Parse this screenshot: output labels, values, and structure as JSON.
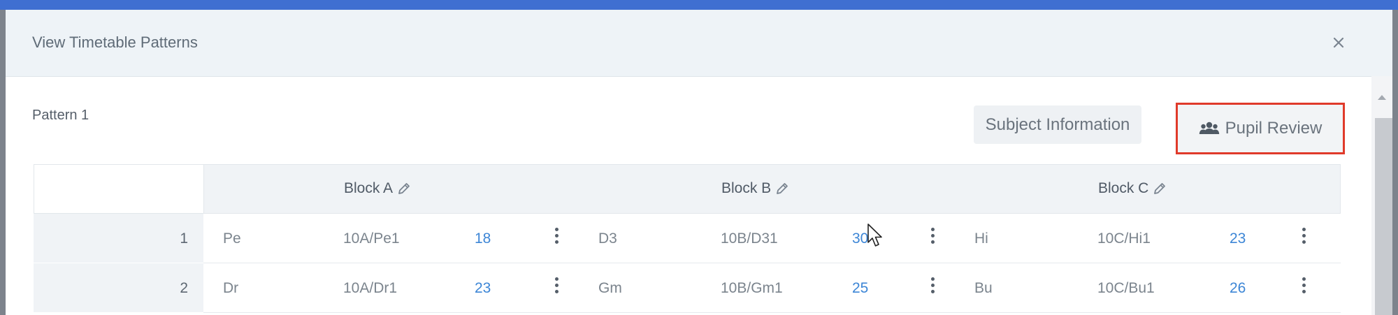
{
  "modal": {
    "title": "View Timetable Patterns",
    "close_icon": "close-icon"
  },
  "pattern": {
    "label": "Pattern 1"
  },
  "actions": {
    "subject_information": "Subject Information",
    "pupil_review": "Pupil Review",
    "pupil_review_icon": "users-icon",
    "highlight_color": "#e03a2a"
  },
  "blocks": [
    {
      "label": "Block A",
      "icon": "pencil-icon"
    },
    {
      "label": "Block B",
      "icon": "pencil-icon"
    },
    {
      "label": "Block C",
      "icon": "pencil-icon"
    }
  ],
  "rows": [
    {
      "number": "1",
      "cells": [
        {
          "subject": "Pe",
          "class": "10A/Pe1",
          "count": "18"
        },
        {
          "subject": "D3",
          "class": "10B/D31",
          "count": "30"
        },
        {
          "subject": "Hi",
          "class": "10C/Hi1",
          "count": "23"
        }
      ]
    },
    {
      "number": "2",
      "cells": [
        {
          "subject": "Dr",
          "class": "10A/Dr1",
          "count": "23"
        },
        {
          "subject": "Gm",
          "class": "10B/Gm1",
          "count": "25"
        },
        {
          "subject": "Bu",
          "class": "10C/Bu1",
          "count": "26"
        }
      ]
    }
  ],
  "colors": {
    "link": "#3d86d6",
    "header_bg": "#eef3f7",
    "accent_bar": "#3f6fd1"
  }
}
